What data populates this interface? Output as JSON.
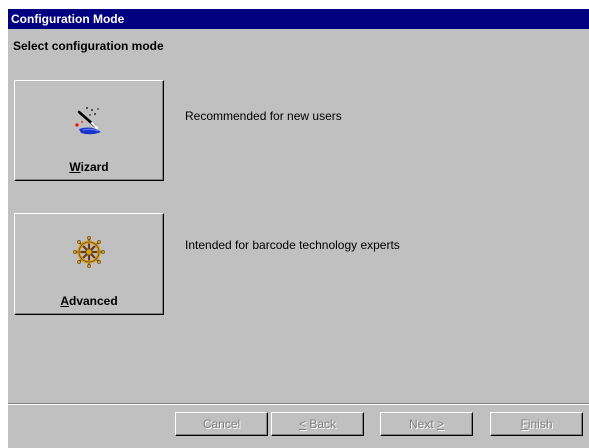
{
  "window": {
    "title": "Configuration Mode",
    "colors": {
      "title_bar": "#000080",
      "face": "#c0c0c0",
      "disabled_text": "#808080"
    }
  },
  "header": {
    "subtitle": "Select configuration mode"
  },
  "options": [
    {
      "icon": "magic-wand-icon",
      "label_accel": "W",
      "label_rest": "izard",
      "description": "Recommended for new users"
    },
    {
      "icon": "ship-wheel-icon",
      "label_accel": "A",
      "label_rest": "dvanced",
      "description": "Intended for barcode technology experts"
    }
  ],
  "footer": {
    "cancel": {
      "label": "Cancel",
      "enabled": false
    },
    "back": {
      "label_accel": "<",
      "label_rest": " Back",
      "enabled": false
    },
    "next": {
      "label": "Next ",
      "label_accel": ">",
      "enabled": false
    },
    "finish": {
      "label_accel": "F",
      "label_rest": "inish",
      "enabled": false
    }
  }
}
